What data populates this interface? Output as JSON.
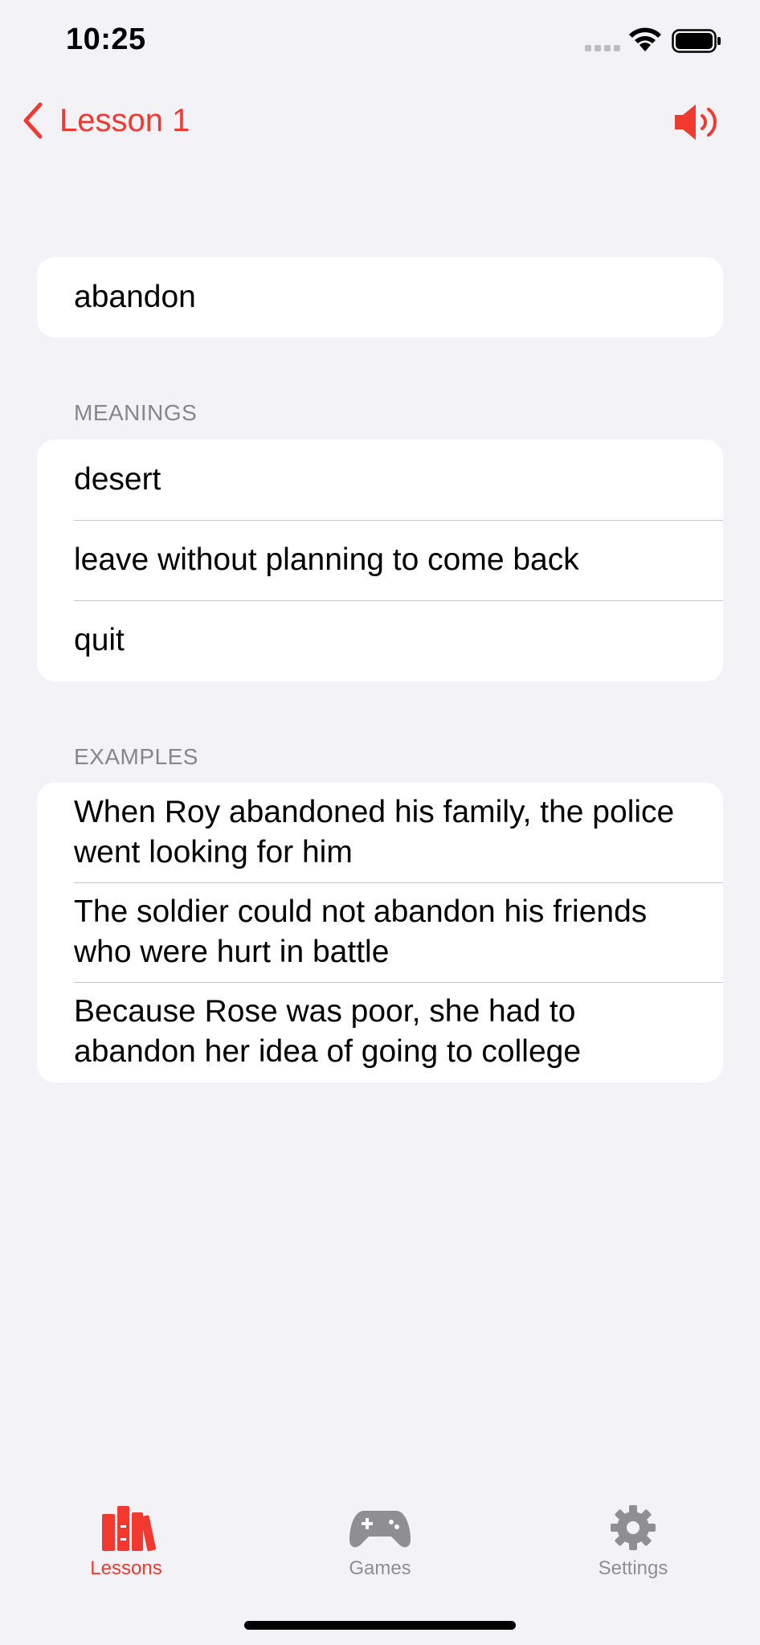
{
  "status_bar": {
    "time": "10:25"
  },
  "nav": {
    "back_label": "Lesson 1"
  },
  "word": "abandon",
  "meanings": {
    "header": "MEANINGS",
    "items": [
      "desert",
      "leave without planning to come back",
      "quit"
    ]
  },
  "examples": {
    "header": "EXAMPLES",
    "items": [
      "When Roy abandoned his family, the police went looking for him",
      "The soldier could not abandon his friends who were hurt in battle",
      "Because Rose was poor, she had to abandon her idea of going to college"
    ]
  },
  "tabs": [
    {
      "label": "Lessons",
      "icon": "books-icon",
      "active": true
    },
    {
      "label": "Games",
      "icon": "gamepad-icon",
      "active": false
    },
    {
      "label": "Settings",
      "icon": "gear-icon",
      "active": false
    }
  ],
  "colors": {
    "accent": "#f2392f",
    "background": "#f2f2f7",
    "inactive": "#8e8e93"
  }
}
